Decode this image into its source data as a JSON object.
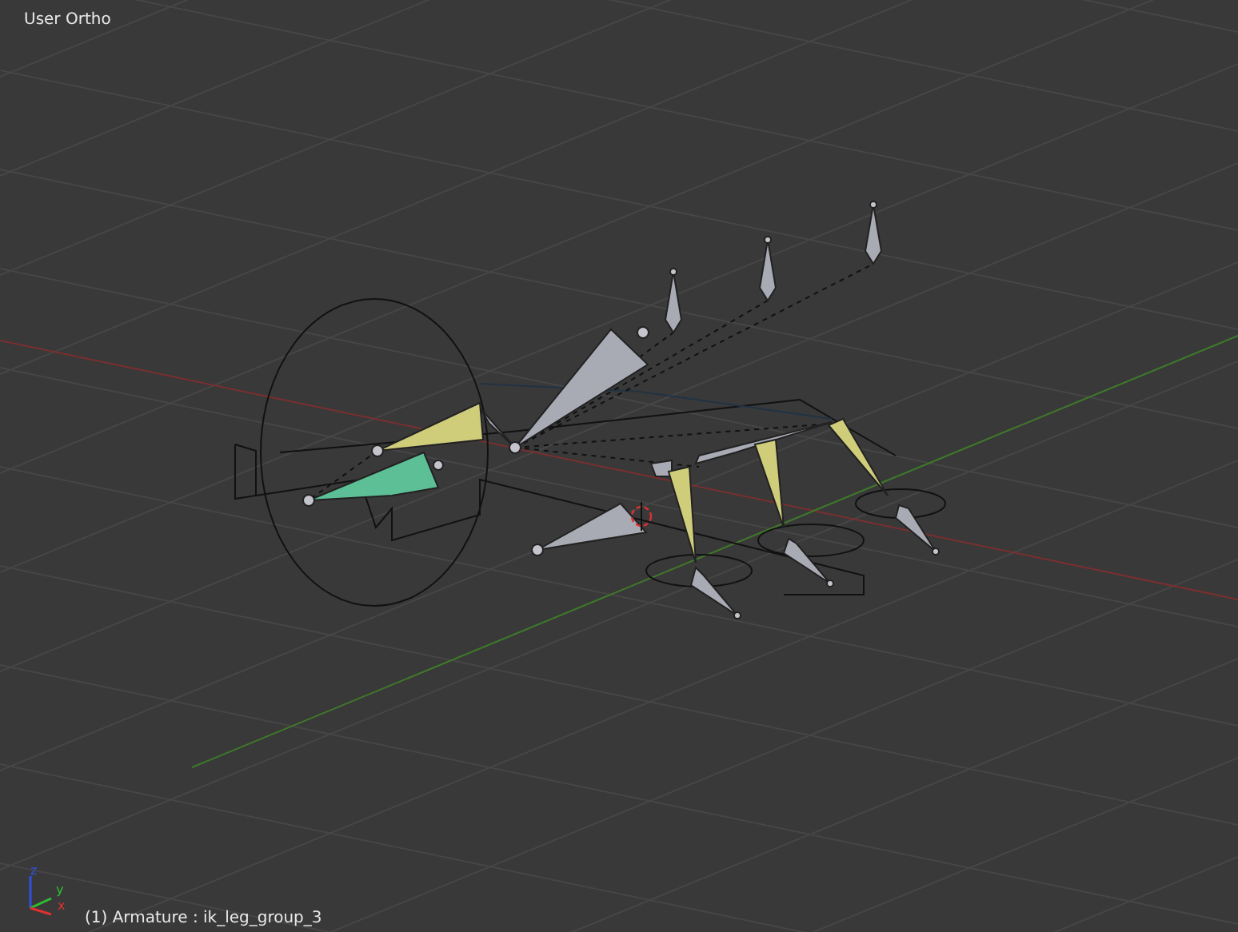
{
  "viewport": {
    "view_label": "User Ortho",
    "axis_gizmo": {
      "labels": [
        "z",
        "y",
        "x"
      ]
    },
    "status_text": "(1) Armature : ik_leg_group_3"
  }
}
